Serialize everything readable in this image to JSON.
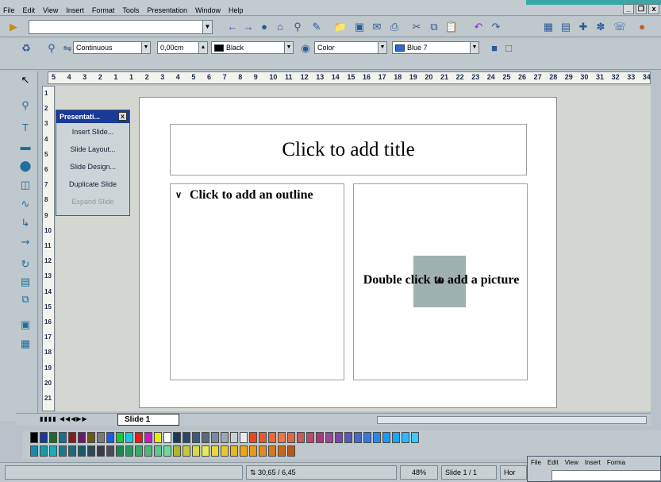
{
  "menu": [
    "File",
    "Edit",
    "View",
    "Insert",
    "Format",
    "Tools",
    "Presentation",
    "Window",
    "Help"
  ],
  "window_controls": [
    "_",
    "❐",
    "x"
  ],
  "toolbar2": {
    "line_style": "Continuous",
    "line_width": "0,00cm",
    "line_color": "Black",
    "area_style": "Color",
    "area_color": "Blue 7",
    "colors": {
      "line": "#000000",
      "area": "#2a6ad8"
    }
  },
  "hruler": [
    "5",
    "4",
    "3",
    "2",
    "1",
    "1",
    "2",
    "3",
    "4",
    "5",
    "6",
    "7",
    "8",
    "9",
    "10",
    "11",
    "12",
    "13",
    "14",
    "15",
    "16",
    "17",
    "18",
    "19",
    "20",
    "21",
    "22",
    "23",
    "24",
    "25",
    "26",
    "27",
    "28",
    "29",
    "30",
    "31",
    "32",
    "33",
    "34"
  ],
  "vruler": [
    "1",
    "2",
    "3",
    "4",
    "5",
    "6",
    "7",
    "8",
    "9",
    "10",
    "11",
    "12",
    "13",
    "14",
    "15",
    "16",
    "17",
    "18",
    "19",
    "20",
    "21"
  ],
  "slide": {
    "title_placeholder": "Click to add title",
    "outline_bullet": "∨",
    "outline_placeholder": "Click to add an outline",
    "picture_placeholder": "Double click to add a picture"
  },
  "presentation_panel": {
    "title": "Presentati...",
    "items": [
      "Insert Slide...",
      "Slide Layout...",
      "Slide Design...",
      "Duplicate Slide",
      "Expand Slide"
    ]
  },
  "tabs": {
    "active": "Slide 1"
  },
  "status": {
    "position": "30,65 / 6,45",
    "zoom": "48%",
    "slide": "Slide 1 / 1",
    "layout": "Hor"
  },
  "mini_window_menu": [
    "File",
    "Edit",
    "View",
    "Insert",
    "Forma"
  ],
  "palette": {
    "row1": [
      "#000000",
      "#1a3a9a",
      "#1e6a2a",
      "#1e6e8e",
      "#8a1a1a",
      "#6a1a6a",
      "#6a5a1a",
      "#7a7a7a",
      "#1a5ae8",
      "#1ac83a",
      "#1ac8d8",
      "#e81a1a",
      "#c81ac8",
      "#e8e81a",
      "#ffffff",
      "#1a3a5a",
      "#2a4a6a",
      "#3a5a7a",
      "#5a6a7a",
      "#7a8a9a",
      "#9aa8b4",
      "#c8d0d8",
      "#e8ecf0",
      "#e8481a",
      "#e85a2a",
      "#e8683a",
      "#e8784a",
      "#d86a4a",
      "#c85a5a",
      "#b84a6a",
      "#a83a7a",
      "#98489a",
      "#7848aa",
      "#5858ba",
      "#4868ca",
      "#3878da",
      "#2888ea",
      "#1898fa",
      "#1aa8ff",
      "#2ab8ff",
      "#3ac8ff"
    ],
    "row2": [
      "#1a8aa8",
      "#1a9aa8",
      "#1aaab8",
      "#1a7a88",
      "#1a6a78",
      "#1a5a68",
      "#2a4a58",
      "#3a3a48",
      "#4a4a58",
      "#1a8a4a",
      "#2a9a5a",
      "#3aaa6a",
      "#4aba7a",
      "#5aca8a",
      "#6ada9a",
      "#aab82a",
      "#c8c83a",
      "#d8d84a",
      "#e8e85a",
      "#e8d83a",
      "#e8c82a",
      "#e8b81a",
      "#e8a81a",
      "#e8981a",
      "#e8881a",
      "#d8781a",
      "#c8681a",
      "#b8581a"
    ]
  }
}
